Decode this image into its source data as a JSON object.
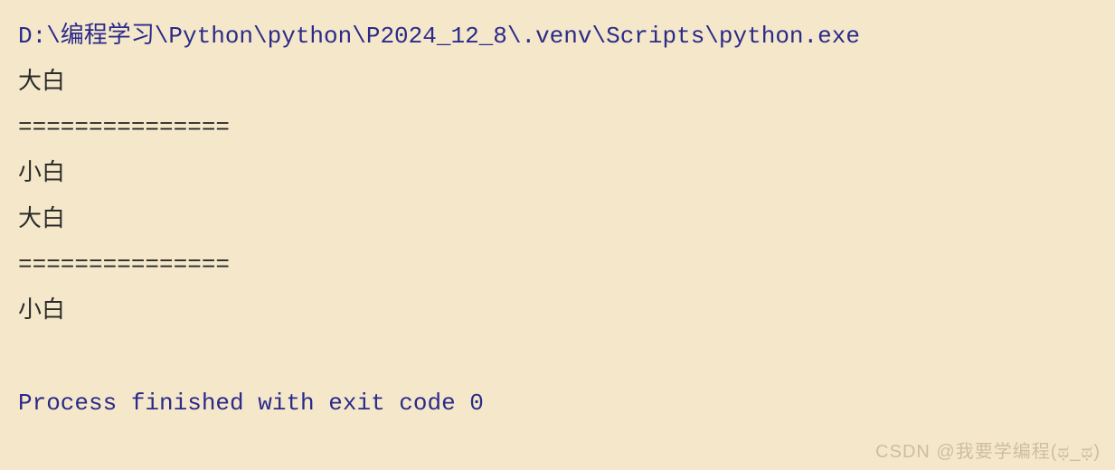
{
  "console": {
    "interpreter_path": "D:\\编程学习\\Python\\python\\P2024_12_8\\.venv\\Scripts\\python.exe",
    "output_lines": [
      "大白",
      "===============",
      "小白",
      "大白",
      "===============",
      "小白"
    ],
    "exit_message": "Process finished with exit code 0"
  },
  "watermark": "CSDN @我要学编程(ಥ_ಥ)"
}
